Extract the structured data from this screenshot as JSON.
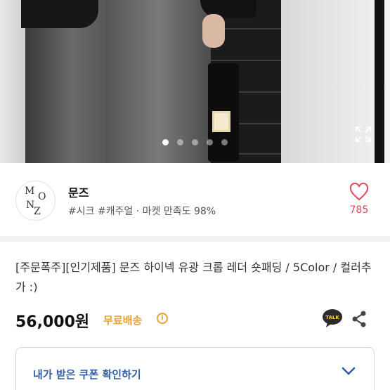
{
  "gallery": {
    "image_count": 5,
    "active_index": 0,
    "expand_icon": "expand-icon"
  },
  "shop": {
    "logo_letters": [
      "M",
      "O",
      "N",
      "Z"
    ],
    "name": "문즈",
    "tags": "#시크 #캐주얼 · 마켓 만족도 98%",
    "likes": "785",
    "heart_icon": "heart-icon"
  },
  "product": {
    "title": "[주문폭주][인기제품] 문즈 하이넥 유광 크롭 레더 숏패딩 / 5Color / 컬러추가 :)",
    "price": "56,000원",
    "shipping": "무료배송",
    "info_icon": "info-icon",
    "talk_icon_label": "TALK",
    "share_icon": "share-icon"
  },
  "coupon": {
    "label": "내가 받은 쿠폰 확인하기",
    "chevron_icon": "chevron-down-icon"
  },
  "colors": {
    "accent_blue": "#2f5ea8",
    "like_red": "#e04a5a",
    "free_shipping": "#e8a13a",
    "talk_yellow": "#f9e000"
  }
}
